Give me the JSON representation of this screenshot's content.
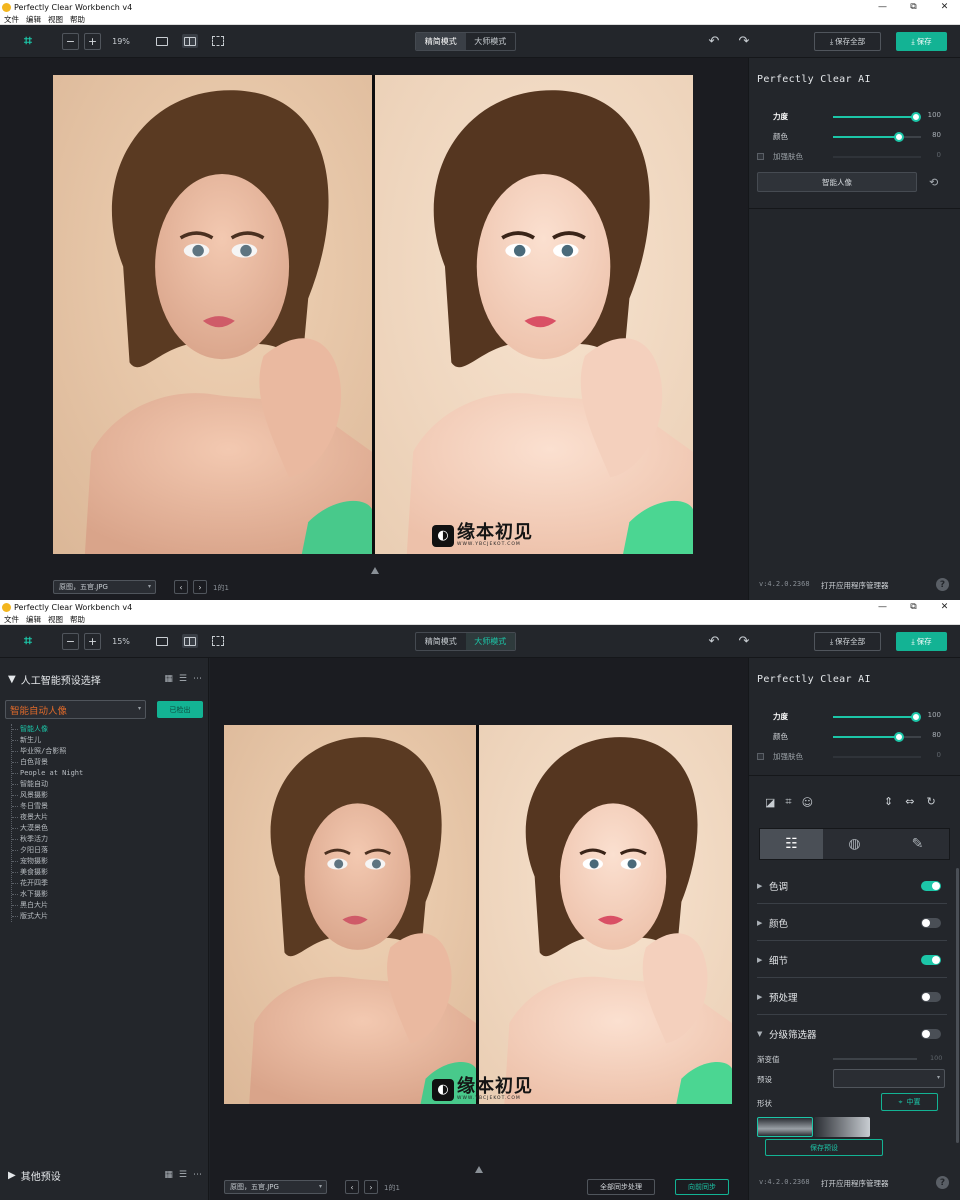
{
  "app": {
    "title": "Perfectly Clear Workbench v4"
  },
  "window_controls": {
    "minimize": "—",
    "restore": "⧉",
    "close": "✕"
  },
  "menu": [
    "文件",
    "编辑",
    "视图",
    "帮助"
  ],
  "toolbar": {
    "zoom_out": "−",
    "zoom_in": "+",
    "mode_simple": "精简模式",
    "mode_master": "大师模式",
    "undo": "↶",
    "redo": "↷",
    "save_all": "保存全部",
    "save": "保存"
  },
  "windows": [
    {
      "zoom": "19%",
      "active_mode": "simple"
    },
    {
      "zoom": "15%",
      "active_mode": "master"
    }
  ],
  "watermark": {
    "main": "缘本初见",
    "sub": "WWW.YBCJEKOT.COM"
  },
  "bottom": {
    "file_name": "原图，五官.JPG",
    "prev": "‹",
    "next": "›",
    "page": "1的1",
    "sync_all": "全部同步处理",
    "sync_forward": "向前同步"
  },
  "right_panel": {
    "title": "Perfectly Clear AI",
    "sliders": [
      {
        "label": "力度",
        "value": 100,
        "display": "100"
      },
      {
        "label": "颜色",
        "value": 80,
        "display": "80"
      },
      {
        "label": "加强肤色",
        "value": 0,
        "display": "0"
      }
    ],
    "preset_button": "智能人像",
    "reset_icon": "⟲",
    "version": "v:4.2.0.2368",
    "app_manager": "打开应用程序管理器",
    "help": "?",
    "adjustments": [
      {
        "name": "色调",
        "on": true,
        "expanded": false
      },
      {
        "name": "颜色",
        "on": false,
        "expanded": false
      },
      {
        "name": "细节",
        "on": true,
        "expanded": false
      },
      {
        "name": "预处理",
        "on": false,
        "expanded": false
      },
      {
        "name": "分级筛选器",
        "on": false,
        "expanded": true
      }
    ],
    "graduated": {
      "gradient_label": "渐变值",
      "gradient_value": "100",
      "preset_label": "预设",
      "shape_label": "形状",
      "center_button": "中置",
      "save_preset": "保存预设"
    }
  },
  "left_panel": {
    "title": "人工智能预设选择",
    "selected_preset": "智能自动人像",
    "apply_button": "已检出",
    "presets": [
      "智能人像",
      "新生儿",
      "毕业照/合影照",
      "白色背景",
      "People at Night",
      "智能自动",
      "风景摄影",
      "冬日雪景",
      "夜景大片",
      "大漠景色",
      "秋季活力",
      "夕阳日落",
      "宠物摄影",
      "美食摄影",
      "花开四季",
      "水下摄影",
      "黑白大片",
      "版式大片"
    ],
    "other_title": "其他预设"
  },
  "colors": {
    "accent": "#1cc6a8",
    "save_green": "#13b394",
    "preset_orange": "#e06a2a",
    "bg_dark": "#1e2126"
  }
}
